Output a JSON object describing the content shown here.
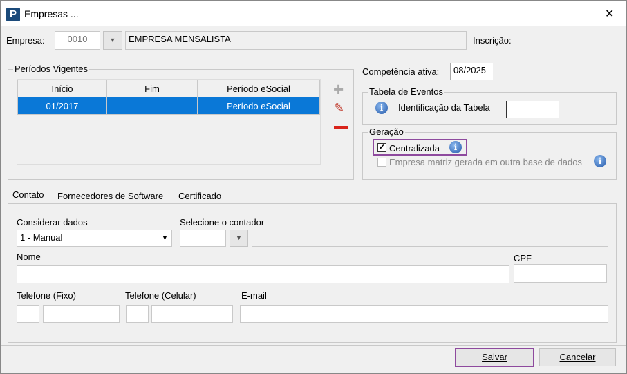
{
  "window": {
    "title": "Empresas ...",
    "close": "✕"
  },
  "empresa": {
    "label": "Empresa:",
    "code": "0010",
    "name": "EMPRESA MENSALISTA",
    "inscricao_label": "Inscrição:"
  },
  "periodos": {
    "title": "Períodos Vigentes",
    "columns": [
      "Início",
      "Fim",
      "Período eSocial"
    ],
    "rows": [
      {
        "inicio": "01/2017",
        "fim": "",
        "periodo": "Período eSocial"
      }
    ]
  },
  "competencia": {
    "label": "Competência ativa:",
    "value": "08/2025"
  },
  "tabela_eventos": {
    "title": "Tabela de Eventos",
    "label": "Identificação da Tabela",
    "value": ""
  },
  "geracao": {
    "title": "Geração",
    "centralizada": {
      "label": "Centralizada",
      "checked": true
    },
    "matriz": {
      "label": "Empresa matriz gerada em outra base de dados",
      "checked": false
    }
  },
  "tabs": [
    "Contato",
    "Fornecedores de Software",
    "Certificado"
  ],
  "contato": {
    "considerar_label": "Considerar dados",
    "considerar_value": "1 - Manual",
    "contador_label": "Selecione o contador",
    "nome_label": "Nome",
    "cpf_label": "CPF",
    "tel_fixo_label": "Telefone (Fixo)",
    "tel_cel_label": "Telefone (Celular)",
    "email_label": "E-mail"
  },
  "buttons": {
    "save": "Salvar",
    "cancel": "Cancelar"
  },
  "colors": {
    "selection": "#0a78d7",
    "highlight": "#8e4a9e"
  }
}
